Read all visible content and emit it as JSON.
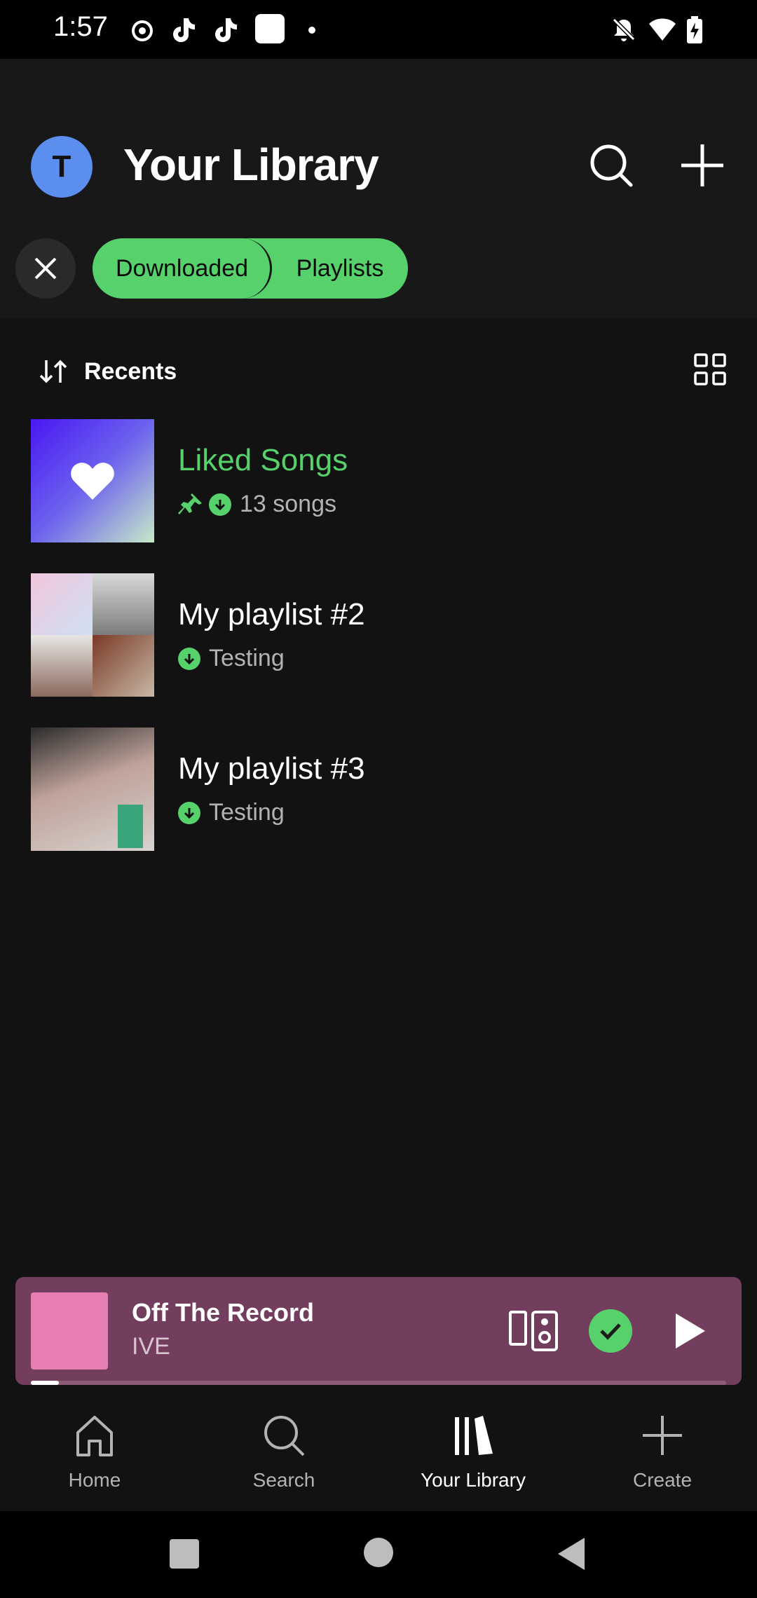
{
  "status_bar": {
    "time": "1:57"
  },
  "header": {
    "avatar_letter": "T",
    "title": "Your Library"
  },
  "filters": {
    "chips": [
      "Downloaded",
      "Playlists"
    ]
  },
  "sort": {
    "label": "Recents"
  },
  "library_items": [
    {
      "title": "Liked Songs",
      "subtitle": "13 songs",
      "pinned": true,
      "downloaded": true,
      "title_color": "#57d16b"
    },
    {
      "title": "My playlist #2",
      "subtitle": "Testing",
      "pinned": false,
      "downloaded": true,
      "title_color": "#ffffff"
    },
    {
      "title": "My playlist #3",
      "subtitle": "Testing",
      "pinned": false,
      "downloaded": true,
      "title_color": "#ffffff"
    }
  ],
  "now_playing": {
    "title": "Off The Record",
    "artist": "IVE",
    "progress_fraction": 0.04
  },
  "bottom_nav": {
    "home": "Home",
    "search": "Search",
    "library": "Your Library",
    "create": "Create"
  },
  "colors": {
    "accent": "#57d16b",
    "background": "#121212",
    "player_bg": "#733d5d",
    "avatar": "#5b8eee"
  }
}
